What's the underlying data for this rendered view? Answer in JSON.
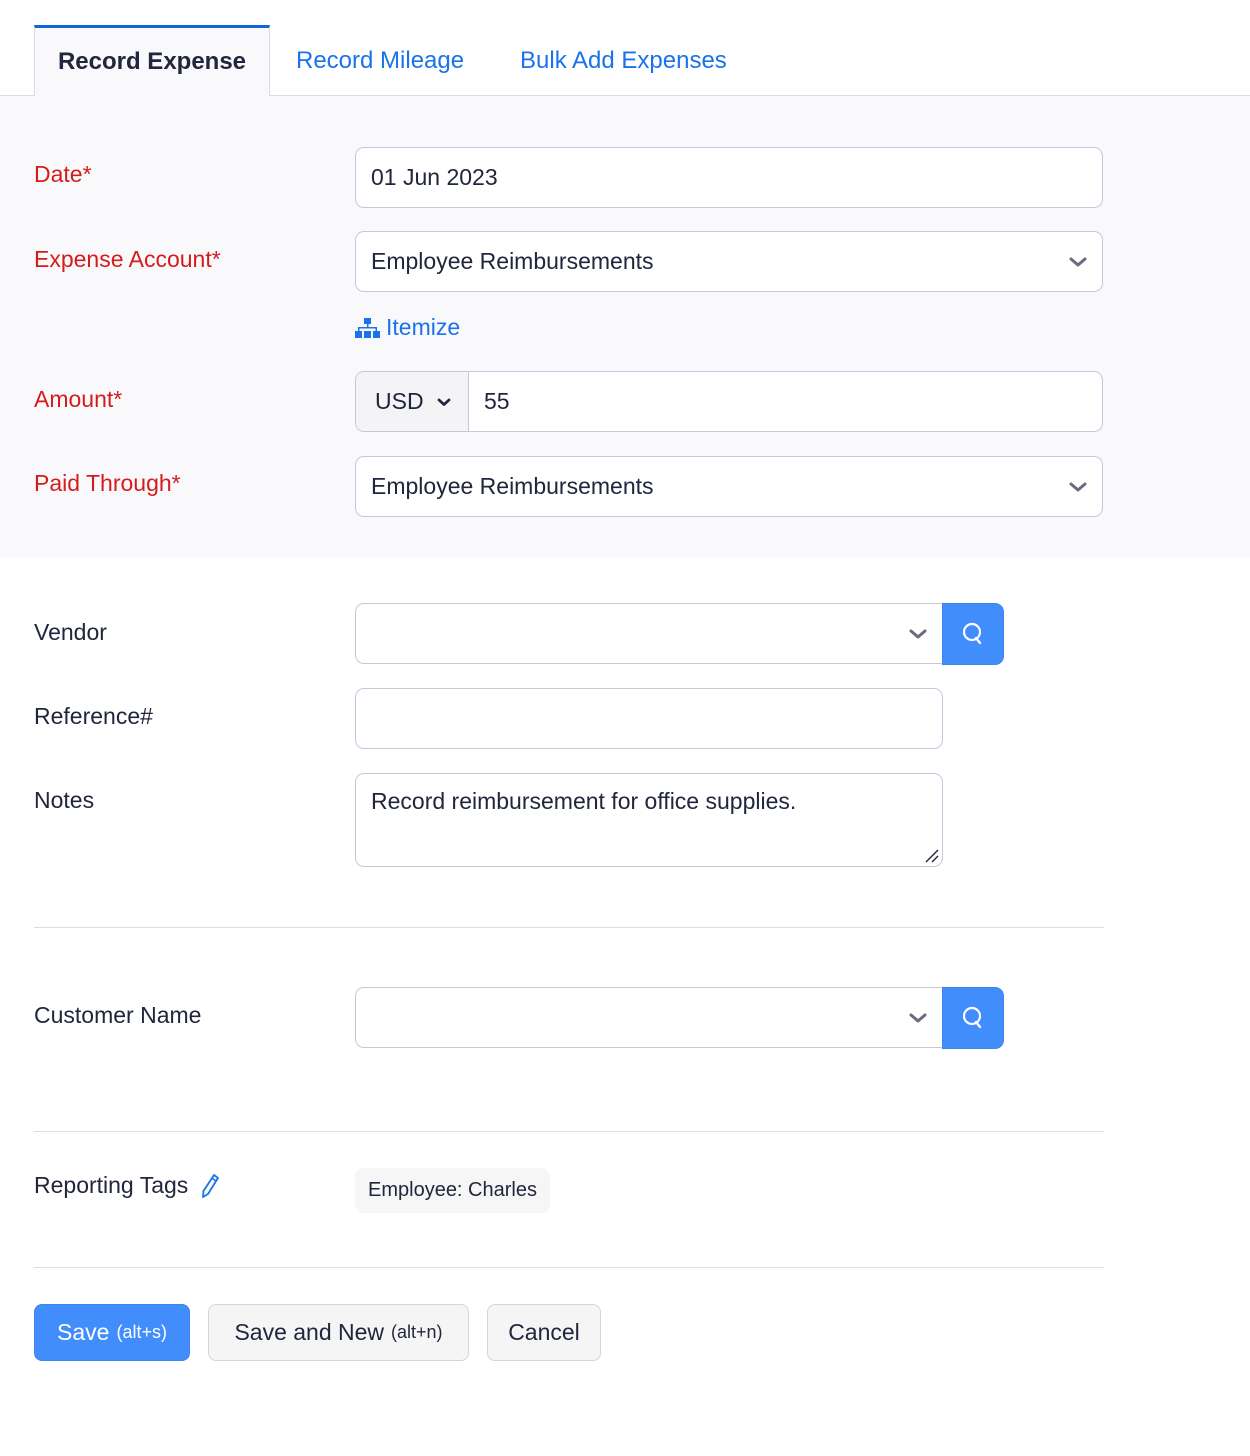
{
  "tabs": [
    {
      "label": "Record Expense",
      "active": true
    },
    {
      "label": "Record Mileage",
      "active": false
    },
    {
      "label": "Bulk Add Expenses",
      "active": false
    }
  ],
  "form": {
    "date": {
      "label": "Date*",
      "value": "01 Jun 2023"
    },
    "expense_account": {
      "label": "Expense Account*",
      "value": "Employee Reimbursements"
    },
    "itemize": {
      "label": "Itemize",
      "icon": "hierarchy-icon"
    },
    "amount": {
      "label": "Amount*",
      "currency": "USD",
      "value": "55"
    },
    "paid_through": {
      "label": "Paid Through*",
      "value": "Employee Reimbursements"
    },
    "vendor": {
      "label": "Vendor",
      "value": ""
    },
    "reference": {
      "label": "Reference#",
      "value": ""
    },
    "notes": {
      "label": "Notes",
      "value": "Record reimbursement for office supplies."
    },
    "customer_name": {
      "label": "Customer Name",
      "value": ""
    },
    "reporting_tags": {
      "label": "Reporting Tags",
      "icon": "pencil-icon",
      "tags": [
        "Employee: Charles"
      ]
    }
  },
  "actions": {
    "save": {
      "label": "Save",
      "shortcut": "(alt+s)"
    },
    "save_and_new": {
      "label": "Save and New",
      "shortcut": "(alt+n)"
    },
    "cancel": {
      "label": "Cancel"
    }
  },
  "colors": {
    "accent": "#408dfb",
    "link": "#1a73e8",
    "required": "#d41c1c",
    "active_tab_border": "#1166d8"
  }
}
